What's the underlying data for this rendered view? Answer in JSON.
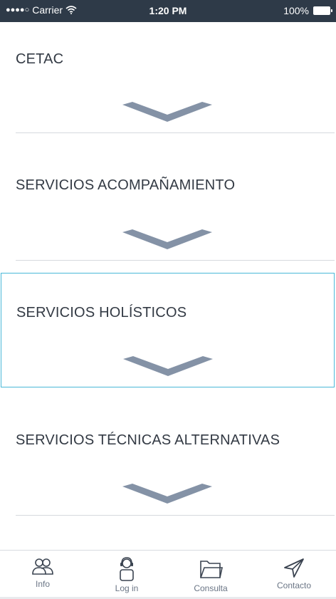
{
  "status_bar": {
    "signal": "●●●●○",
    "carrier": "Carrier",
    "time": "1:20 PM",
    "battery": "100%"
  },
  "sections": [
    {
      "title": "CETAC",
      "icon": "chevron-down-icon"
    },
    {
      "title": "SERVICIOS ACOMPAÑAMIENTO",
      "icon": "chevron-down-icon"
    },
    {
      "title": "SERVICIOS HOLÍSTICOS",
      "icon": "chevron-down-icon"
    },
    {
      "title": "SERVICIOS TÉCNICAS ALTERNATIVAS",
      "icon": "chevron-down-icon"
    }
  ],
  "tabs": [
    {
      "label": "Info",
      "icon": "users-icon"
    },
    {
      "label": "Log in",
      "icon": "user-headset-icon"
    },
    {
      "label": "Consulta",
      "icon": "folder-icon"
    },
    {
      "label": "Contacto",
      "icon": "paper-plane-icon"
    }
  ],
  "colors": {
    "status_bar_bg": "#2e3a48",
    "title_text": "#333a44",
    "chevron": "#6f7f97",
    "selected_border": "#49b8d8",
    "tab_icon": "#6a7585"
  }
}
